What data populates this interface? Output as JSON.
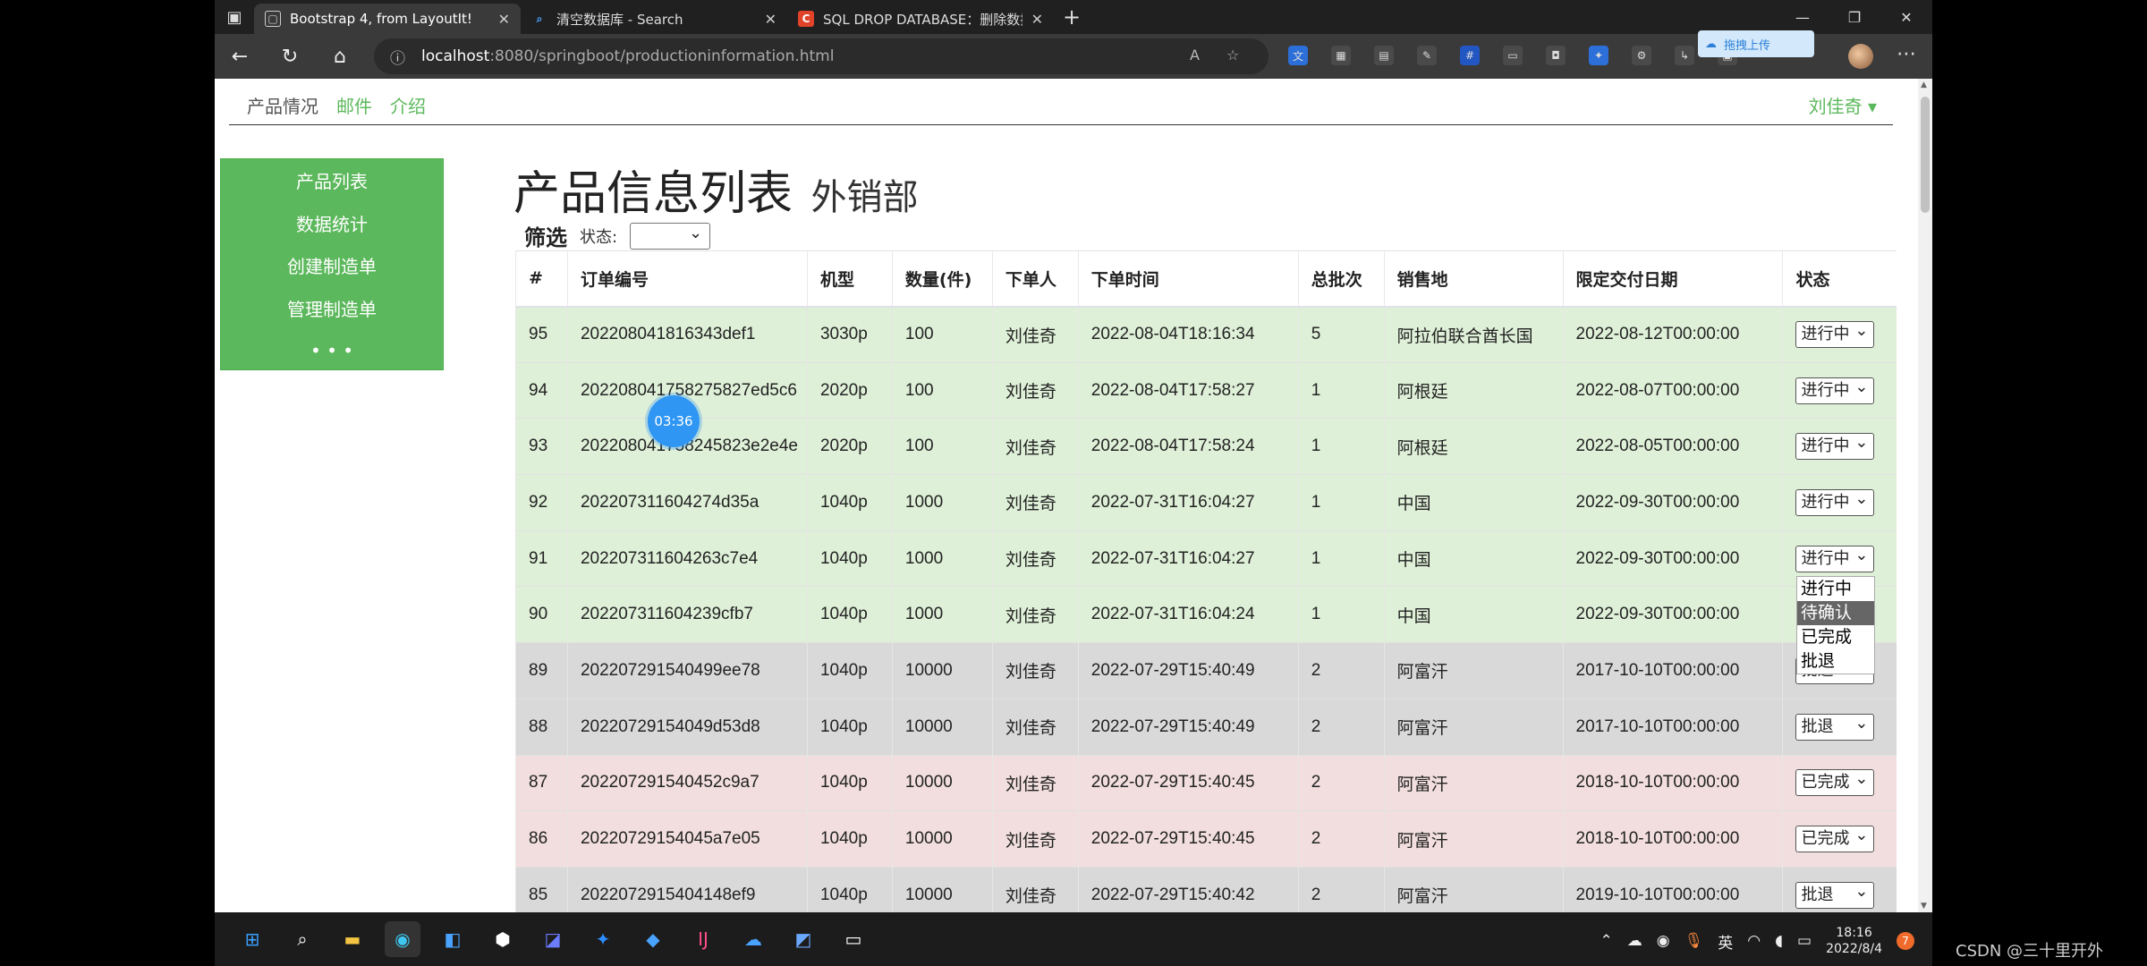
{
  "browser": {
    "tabs": [
      {
        "title": "Bootstrap 4, from LayoutIt!",
        "icon": "page-icon",
        "active": true
      },
      {
        "title": "清空数据库 - Search",
        "icon": "search-icon",
        "active": false
      },
      {
        "title": "SQL DROP DATABASE：删除数据",
        "icon": "csdn-icon",
        "active": false
      }
    ],
    "address_host": "localhost",
    "address_rest": ":8080/springboot/productioninformation.html",
    "upload_label": "拖拽上传"
  },
  "nav": {
    "links": [
      "产品情况",
      "邮件",
      "介绍"
    ],
    "user": "刘佳奇 ▾"
  },
  "sidebar": {
    "items": [
      "产品列表",
      "数据统计",
      "创建制造单",
      "管理制造单",
      "• • •"
    ]
  },
  "page": {
    "title": "产品信息列表",
    "subtitle": "外销部",
    "filter_label": "筛选",
    "status_label": "状态:"
  },
  "table": {
    "headers": [
      "#",
      "订单编号",
      "机型",
      "数量(件)",
      "下单人",
      "下单时间",
      "总批次",
      "销售地",
      "限定交付日期",
      "状态"
    ],
    "rows": [
      {
        "id": "95",
        "order": "202208041816343def1",
        "model": "3030p",
        "qty": "100",
        "person": "刘佳奇",
        "time": "2022-08-04T18:16:34",
        "batch": "5",
        "place": "阿拉伯联合酋长国",
        "due": "2022-08-12T00:00:00",
        "status": "进行中",
        "tone": "ok"
      },
      {
        "id": "94",
        "order": "202208041758275827ed5c6",
        "model": "2020p",
        "qty": "100",
        "person": "刘佳奇",
        "time": "2022-08-04T17:58:27",
        "batch": "1",
        "place": "阿根廷",
        "due": "2022-08-07T00:00:00",
        "status": "进行中",
        "tone": "ok"
      },
      {
        "id": "93",
        "order": "202208041758245823e2e4e",
        "model": "2020p",
        "qty": "100",
        "person": "刘佳奇",
        "time": "2022-08-04T17:58:24",
        "batch": "1",
        "place": "阿根廷",
        "due": "2022-08-05T00:00:00",
        "status": "进行中",
        "tone": "ok"
      },
      {
        "id": "92",
        "order": "202207311604274d35a",
        "model": "1040p",
        "qty": "1000",
        "person": "刘佳奇",
        "time": "2022-07-31T16:04:27",
        "batch": "1",
        "place": "中国",
        "due": "2022-09-30T00:00:00",
        "status": "进行中",
        "tone": "ok"
      },
      {
        "id": "91",
        "order": "202207311604263c7e4",
        "model": "1040p",
        "qty": "1000",
        "person": "刘佳奇",
        "time": "2022-07-31T16:04:27",
        "batch": "1",
        "place": "中国",
        "due": "2022-09-30T00:00:00",
        "status": "进行中",
        "tone": "ok"
      },
      {
        "id": "90",
        "order": "202207311604239cfb7",
        "model": "1040p",
        "qty": "1000",
        "person": "刘佳奇",
        "time": "2022-07-31T16:04:24",
        "batch": "1",
        "place": "中国",
        "due": "2022-09-30T00:00:00",
        "status": "",
        "tone": "ok"
      },
      {
        "id": "89",
        "order": "202207291540499ee78",
        "model": "1040p",
        "qty": "10000",
        "person": "刘佳奇",
        "time": "2022-07-29T15:40:49",
        "batch": "2",
        "place": "阿富汗",
        "due": "2017-10-10T00:00:00",
        "status": "批退",
        "tone": "rej"
      },
      {
        "id": "88",
        "order": "20220729154049d53d8",
        "model": "1040p",
        "qty": "10000",
        "person": "刘佳奇",
        "time": "2022-07-29T15:40:49",
        "batch": "2",
        "place": "阿富汗",
        "due": "2017-10-10T00:00:00",
        "status": "批退",
        "tone": "rej"
      },
      {
        "id": "87",
        "order": "202207291540452c9a7",
        "model": "1040p",
        "qty": "10000",
        "person": "刘佳奇",
        "time": "2022-07-29T15:40:45",
        "batch": "2",
        "place": "阿富汗",
        "due": "2018-10-10T00:00:00",
        "status": "已完成",
        "tone": "done"
      },
      {
        "id": "86",
        "order": "20220729154045a7e05",
        "model": "1040p",
        "qty": "10000",
        "person": "刘佳奇",
        "time": "2022-07-29T15:40:45",
        "batch": "2",
        "place": "阿富汗",
        "due": "2018-10-10T00:00:00",
        "status": "已完成",
        "tone": "done"
      },
      {
        "id": "85",
        "order": "2022072915404148ef9",
        "model": "1040p",
        "qty": "10000",
        "person": "刘佳奇",
        "time": "2022-07-29T15:40:42",
        "batch": "2",
        "place": "阿富汗",
        "due": "2019-10-10T00:00:00",
        "status": "批退",
        "tone": "rej"
      }
    ]
  },
  "dropdown": {
    "options": [
      "进行中",
      "待确认",
      "已完成",
      "批退"
    ],
    "highlighted": "待确认"
  },
  "overlay": {
    "timer": "03:36"
  },
  "taskbar": {
    "ime": "英",
    "time": "18:16",
    "date": "2022/8/4",
    "badge": "7"
  },
  "watermark": "CSDN @三十里开外",
  "colors": {
    "accent_green": "#5cb85c",
    "row_success": "#dff0d8",
    "row_rejected": "#d9d9d9",
    "row_done": "#f2dede"
  }
}
